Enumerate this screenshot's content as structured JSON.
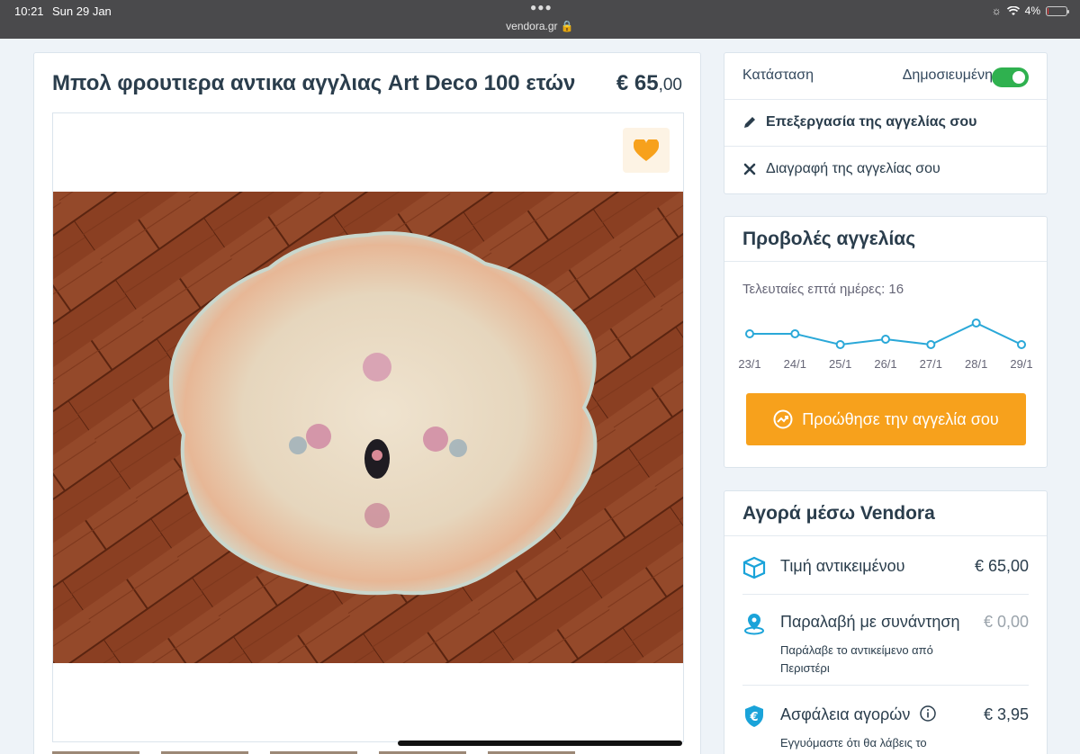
{
  "status_bar": {
    "time": "10:21",
    "date": "Sun 29 Jan",
    "url": "vendora.gr",
    "battery": "4%",
    "battery_level": 0.04
  },
  "listing": {
    "title": "Μπολ φρουτιερα αντικα αγγλιας Art Deco 100 ετών",
    "price_main": "€ 65",
    "price_cents": ",00",
    "favorite_icon": "heart-icon"
  },
  "manage": {
    "status_label": "Κατάσταση",
    "status_value": "Δημοσιευμένη",
    "status_on": true,
    "edit_label": "Επεξεργασία της αγγελίας σου",
    "delete_label": "Διαγραφή της αγγελίας σου"
  },
  "views": {
    "heading": "Προβολές αγγελίας",
    "last_seven": "Τελευταίες επτά ημέρες: 16",
    "promote_label": "Προώθησε την αγγελία σου"
  },
  "chart_data": {
    "type": "line",
    "categories": [
      "23/1",
      "24/1",
      "25/1",
      "26/1",
      "27/1",
      "28/1",
      "29/1"
    ],
    "values": [
      3,
      3,
      1,
      2,
      1,
      5,
      1
    ],
    "color": "#2aa8d8"
  },
  "buy": {
    "heading": "Αγορά μέσω Vendora",
    "item_price_label": "Τιμή αντικειμένου",
    "item_price_value": "€ 65,00",
    "pickup_label": "Παραλαβή με συνάντηση",
    "pickup_value": "€ 0,00",
    "pickup_sub": "Παράλαβε το αντικείμενο από Περιστέρι",
    "insurance_label": "Ασφάλεια αγορών",
    "insurance_value": "€ 3,95",
    "insurance_sub": "Εγγυόμαστε ότι θα λάβεις το αντικείμενο ή τα χρήματά σου"
  },
  "colors": {
    "accent": "#f7a11c",
    "toggle_on": "#2fb14f",
    "icon_blue": "#1aa3d9",
    "heading": "#2a3d4c"
  }
}
